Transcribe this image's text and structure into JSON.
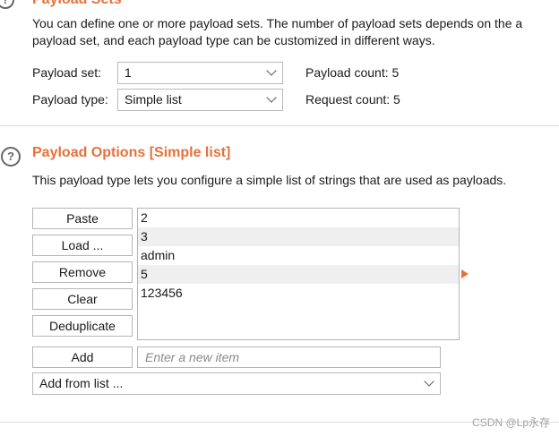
{
  "payload_sets": {
    "title": "Payload Sets",
    "description_line1": "You can define one or more payload sets. The number of payload sets depends on the a",
    "description_line2": "payload set, and each payload type can be customized in different ways.",
    "payload_set_label": "Payload set:",
    "payload_set_value": "1",
    "payload_count_label": "Payload count: 5",
    "payload_type_label": "Payload type:",
    "payload_type_value": "Simple list",
    "request_count_label": "Request count: 5"
  },
  "payload_options": {
    "help_icon_glyph": "?",
    "title": "Payload Options [Simple list]",
    "description": "This payload type lets you configure a simple list of strings that are used as payloads.",
    "buttons": {
      "paste": "Paste",
      "load": "Load ...",
      "remove": "Remove",
      "clear": "Clear",
      "deduplicate": "Deduplicate",
      "add": "Add"
    },
    "items": [
      "2",
      "3",
      "admin",
      "5",
      "123456"
    ],
    "new_item_placeholder": "Enter a new item",
    "add_from_list_value": "Add from list ..."
  },
  "colors": {
    "accent": "#e8703a",
    "highlight_row": "#efefef"
  },
  "watermark": "CSDN @Lp永存"
}
